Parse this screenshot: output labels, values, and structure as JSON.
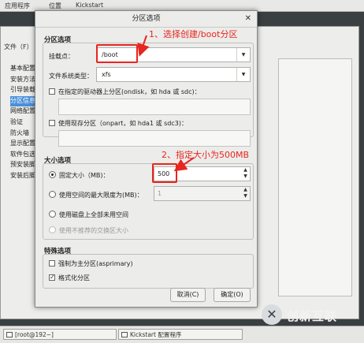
{
  "topbar": {
    "apps": "应用程序",
    "places": "位置",
    "kickstart": "Kickstart"
  },
  "bgwindow": {
    "menu": "文件（F）",
    "list": [
      "基本配置",
      "安装方法",
      "引导装载",
      "分区信息",
      "网络配置",
      "验证",
      "防火墙",
      "显示配置",
      "软件包选",
      "预安装脚",
      "安装后脚"
    ],
    "selected_index": 3
  },
  "dialog": {
    "title": "分区选项",
    "partition_section": "分区选项",
    "mount_label": "挂载点：",
    "mount_value": "/boot",
    "fstype_label": "文件系统类型：",
    "fstype_value": "xfs",
    "ondisk_label": "在指定的驱动器上分区(ondisk，如 hda 或 sdc)：",
    "onpart_label": "使用现存分区（onpart，如 hda1 或 sdc3)：",
    "size_section": "大小选项",
    "fixed_label": "固定大小（MB)：",
    "fixed_value": "500",
    "max_label": "使用空间的最大限度为(MB)：",
    "max_value": "1",
    "fill_label": "使用磁盘上全部未用空间",
    "swap_label": "使用不推荐的交换区大小",
    "special_section": "特殊选项",
    "primary_label": "强制为主分区(asprimary)",
    "format_label": "格式化分区",
    "cancel": "取消(C)",
    "ok": "确定(O)"
  },
  "annotations": {
    "step1": "1、选择创建/boot分区",
    "step2": "2、指定大小为500MB",
    "color": "#e8251f"
  },
  "taskbar": {
    "terminal": "[root@192~]",
    "kickstart": "Kickstart 配置程序"
  },
  "logo": {
    "mark": "✕",
    "text": "创新互联"
  }
}
